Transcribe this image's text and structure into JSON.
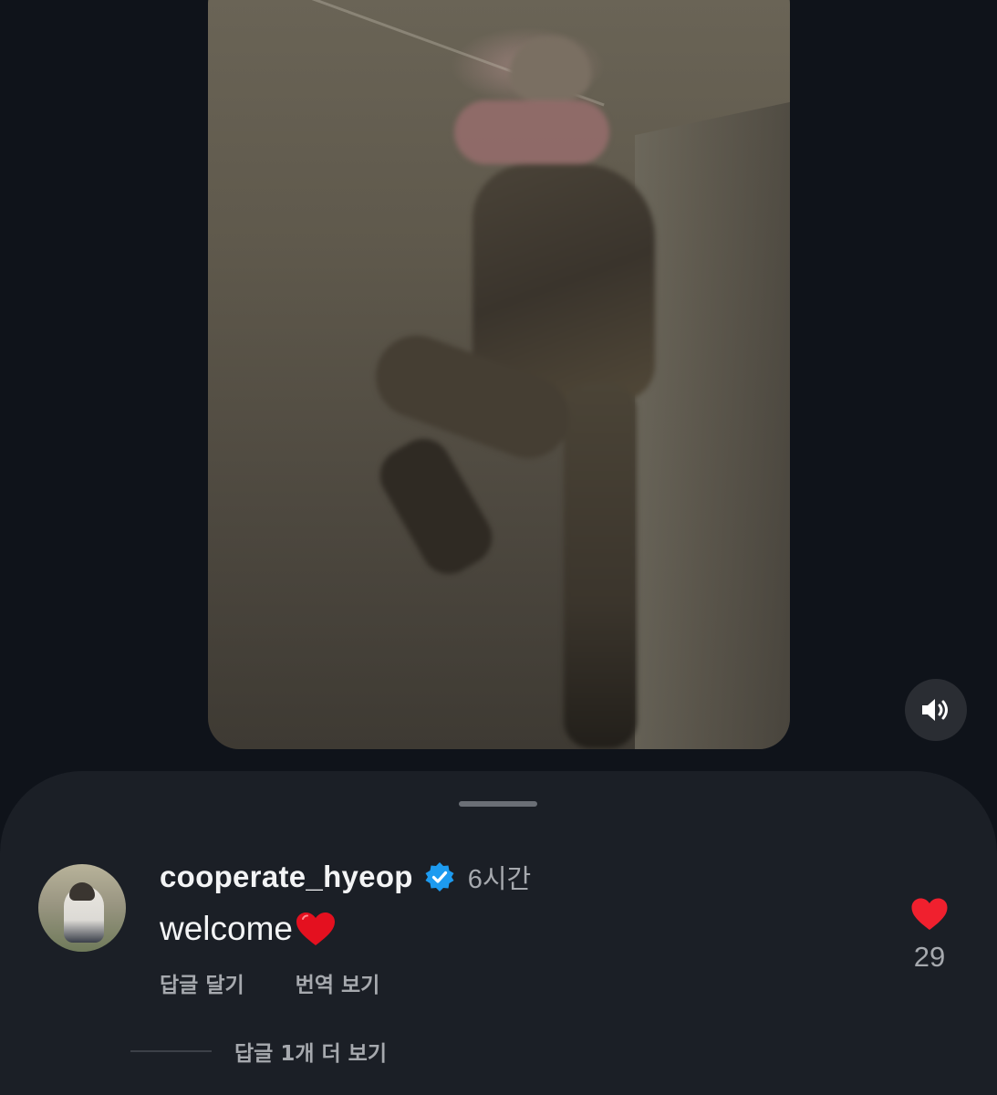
{
  "video": {
    "muted_state": "sound-on"
  },
  "comment": {
    "username": "cooperate_hyeop",
    "verified": true,
    "time": "6시간",
    "text": "welcome",
    "emoji": "heart-emoji",
    "reply_label": "답글 달기",
    "translate_label": "번역 보기",
    "likes": "29",
    "more_replies_label": "답글 1개 더 보기"
  },
  "colors": {
    "background": "#0f131a",
    "sheet": "#1b1f26",
    "verified_blue": "#1d9bf0",
    "like_red": "#f0202e",
    "secondary_text": "#a6a9ae"
  }
}
